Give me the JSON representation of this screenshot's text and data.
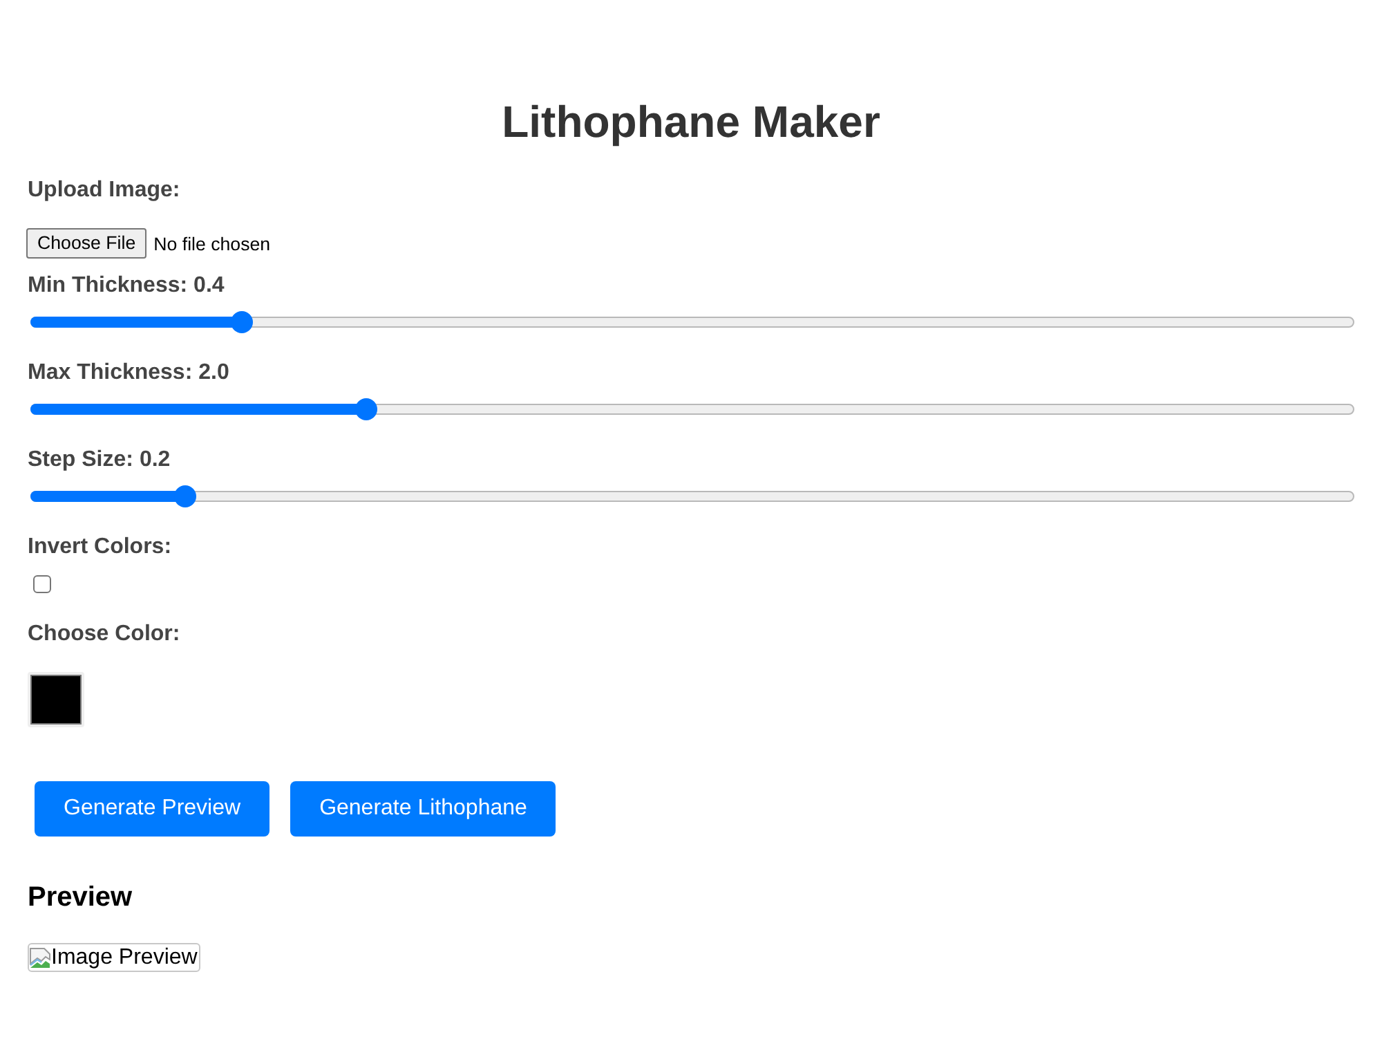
{
  "title": "Lithophane Maker",
  "upload": {
    "label": "Upload Image:",
    "button": "Choose File",
    "status": "No file chosen"
  },
  "sliders": [
    {
      "label": "Min Thickness:",
      "reading": "0.4",
      "level": 0.16
    },
    {
      "label": "Max Thickness:",
      "reading": "2.0",
      "level": 0.254
    },
    {
      "label": "Step Size:",
      "reading": "0.2",
      "level": 0.117
    }
  ],
  "invert": {
    "label": "Invert Colors:",
    "checked": false
  },
  "color_picker": {
    "label": "Choose Color:",
    "color": "#000000"
  },
  "buttons": [
    "Generate Preview",
    "Generate Lithophane"
  ],
  "preview": {
    "heading": "Preview",
    "image_alt": "Image Preview"
  }
}
